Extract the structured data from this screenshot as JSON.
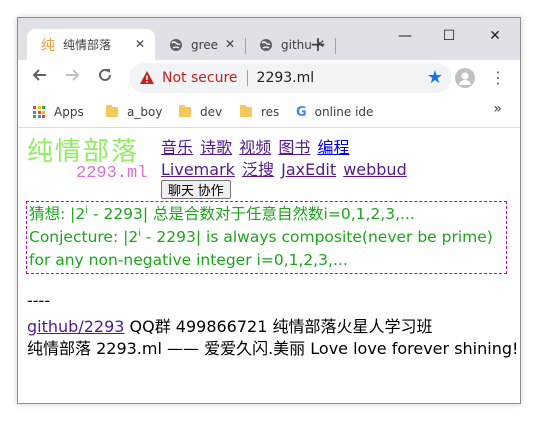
{
  "browser": {
    "tabs": [
      {
        "title": "纯情部落",
        "favicon": "纯",
        "active": true
      },
      {
        "title": "gree",
        "favicon": "globe-icon",
        "active": false
      },
      {
        "title": "githu",
        "favicon": "globe-icon",
        "active": false
      }
    ],
    "new_tab": "+",
    "window_controls": {
      "minimize": "—",
      "maximize": "☐",
      "close": "✕"
    },
    "security_label": "Not secure",
    "url": "2293.ml",
    "bookmarks": [
      {
        "label": "Apps",
        "icon": "apps-grid-icon"
      },
      {
        "label": "a_boy",
        "icon": "folder-icon"
      },
      {
        "label": "dev",
        "icon": "folder-icon"
      },
      {
        "label": "res",
        "icon": "folder-icon"
      },
      {
        "label": "online ide",
        "icon": "google-icon"
      }
    ],
    "colors": {
      "secure_warning": "#c5221f",
      "star": "#1a73e8",
      "tab_bar": "#dee1e6"
    }
  },
  "page": {
    "logo_main": "纯情部落",
    "logo_sub": "2293.ml",
    "nav_links_row1": [
      "音乐",
      "诗歌",
      "视频",
      "图书",
      "编程"
    ],
    "nav_links_row2": [
      "Livemark",
      "泛搜",
      "JaxEdit",
      "webbud"
    ],
    "chat_button": "聊天 协作",
    "conjecture_cn_a": "猜想: |2",
    "conjecture_sup": "i",
    "conjecture_cn_b": " - 2293| 总是合数对于任意自然数i=0,1,2,3,...",
    "conjecture_en_a": "Conjecture: |2",
    "conjecture_en_b": " - 2293| is always composite(never be prime) for any non-negative integer i=0,1,2,3,...",
    "divider": "----",
    "github_link": "github/2293",
    "qq_text": " QQ群 499866721 纯情部落火星人学习班",
    "footer": "纯情部落 2293.ml —— 爱爱久闪.美丽 Love love forever shining!",
    "colors": {
      "logo": "#90ee60",
      "logo_sub": "#d86fd0",
      "conjecture": "#1da51d",
      "box_border": "#b00fb0"
    }
  }
}
